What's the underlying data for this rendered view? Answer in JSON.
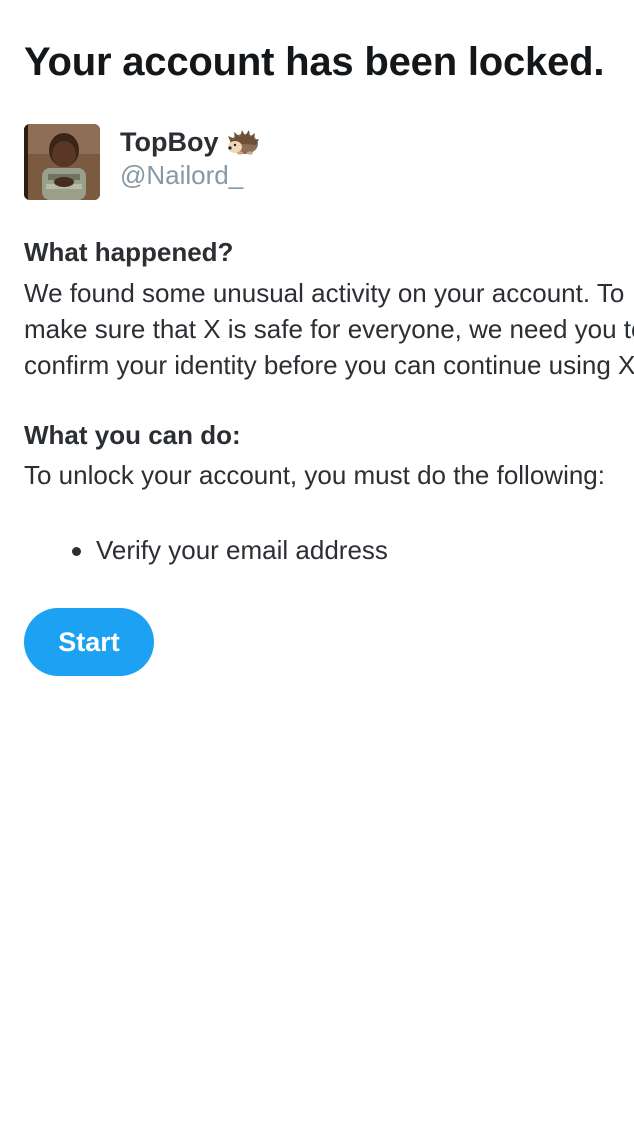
{
  "page": {
    "title": "Your account has been locked."
  },
  "account": {
    "display_name": "TopBoy",
    "name_emoji": "hedgehog-icon",
    "handle": "@Nailord_"
  },
  "what_happened": {
    "heading": "What happened?",
    "lines": [
      "We found some unusual activity on your account. To",
      "make sure that X is safe for everyone, we need you to",
      "confirm your identity before you can continue using X."
    ]
  },
  "what_you_can_do": {
    "heading": "What you can do:",
    "text": "To unlock your account, you must do the following:",
    "steps": [
      "Verify your email address"
    ]
  },
  "actions": {
    "start_label": "Start"
  },
  "colors": {
    "accent": "#1da1f2",
    "text": "#2b2f33",
    "handle": "#8899a6"
  }
}
